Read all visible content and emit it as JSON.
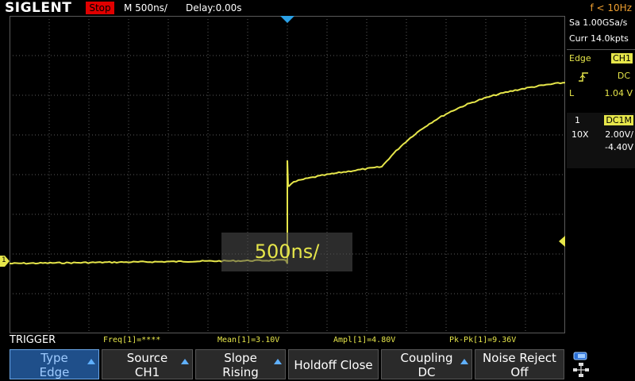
{
  "topbar": {
    "brand": "SIGLENT",
    "run_state": "Stop",
    "timebase": "M 500ns/",
    "delay": "Delay:0.00s",
    "freq": "f < 10Hz"
  },
  "right_panel": {
    "sample_rate": "Sa 1.00GSa/s",
    "curr_points": "Curr 14.0kpts",
    "trigger": {
      "type_label": "Edge",
      "source": "CH1",
      "coupling": "DC",
      "level_prefix": "L",
      "level": "1.04 V"
    },
    "channel": {
      "number": "1",
      "coupling": "DC1M",
      "probe": "10X",
      "scale": "2.00V/",
      "offset": "-4.40V"
    }
  },
  "hud": {
    "text": "500ns/"
  },
  "markers": {
    "ch1": "1"
  },
  "measurements": {
    "menu_title": "TRIGGER",
    "freq": "Freq[1]=****",
    "mean": "Mean[1]=3.10V",
    "ampl": "Ampl[1]=4.80V",
    "pkpk": "Pk-Pk[1]=9.36V"
  },
  "softkeys": [
    {
      "line1": "Type",
      "line2": "Edge",
      "active": true,
      "has_arrow": true
    },
    {
      "line1": "Source",
      "line2": "CH1",
      "active": false,
      "has_arrow": true
    },
    {
      "line1": "Slope",
      "line2": "Rising",
      "active": false,
      "has_arrow": true
    },
    {
      "line1": "Holdoff Close",
      "line2": "",
      "active": false,
      "has_arrow": false
    },
    {
      "line1": "Coupling",
      "line2": "DC",
      "active": false,
      "has_arrow": true
    },
    {
      "line1": "Noise Reject",
      "line2": "Off",
      "active": false,
      "has_arrow": false
    }
  ],
  "colors": {
    "trace": "#e6e64a",
    "grid": "#5a5a5a",
    "trigger_marker": "#2aa0e6",
    "run_state": "#e00000",
    "freq_text": "#f0a030",
    "active_softkey": "#1f4f8a"
  }
}
